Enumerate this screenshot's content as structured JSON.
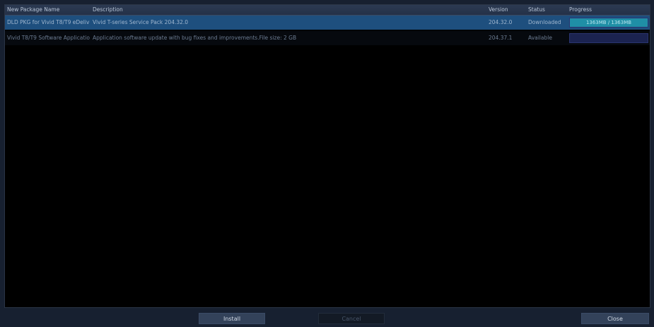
{
  "table": {
    "columns": [
      "New Package Name",
      "Description",
      "Version",
      "Status",
      "Progress"
    ],
    "rows": [
      {
        "name": "DLD PKG for Vivid T8/T9 eDeliv",
        "description": "Vivid T-series Service Pack 204.32.0",
        "version": "204.32.0",
        "status": "Downloaded",
        "progress_text": "1363MB / 1363MB",
        "progress_fraction": 1.0,
        "selected": true
      },
      {
        "name": "Vivid T8/T9 Software Applicatio",
        "description": "Application software update with bug fixes and improvements.File size: 2 GB",
        "version": "204.37.1",
        "status": "Available",
        "progress_text": "",
        "progress_fraction": 0.0,
        "selected": false
      }
    ]
  },
  "footer": {
    "install_label": "Install",
    "cancel_label": "Cancel",
    "close_label": "Close"
  },
  "colors": {
    "selected_row": "#1e4f7e",
    "progress_fill": "#1f8fa6",
    "background": "#000000"
  }
}
